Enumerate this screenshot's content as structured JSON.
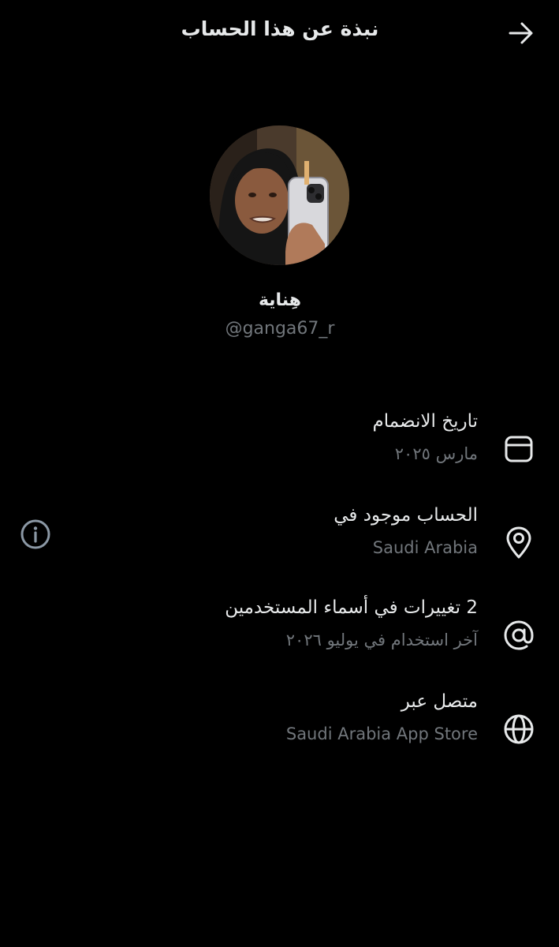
{
  "header": {
    "title": "نبذة عن هذا الحساب",
    "back_icon": "arrow-right-icon"
  },
  "profile": {
    "display_name": "هِناية",
    "handle": "@ganga67_r",
    "avatar": "profile-photo"
  },
  "rows": [
    {
      "icon": "calendar-icon",
      "title": "تاريخ الانضمام",
      "subtitle": "مارس ٢٠٢٥"
    },
    {
      "icon": "location-pin-icon",
      "title": "الحساب موجود في",
      "subtitle": "Saudi Arabia",
      "info_icon": "info-icon"
    },
    {
      "icon": "at-sign-icon",
      "title": "2 تغييرات في أسماء المستخدمين",
      "subtitle": "آخر استخدام في يوليو ٢٠٢٦"
    },
    {
      "icon": "globe-icon",
      "title": "متصل عبر",
      "subtitle": "Saudi Arabia App Store"
    }
  ],
  "colors": {
    "background": "#000000",
    "primary_text": "#e7e9ea",
    "secondary_text": "#71767b",
    "info_icon": "#8b98a5"
  }
}
